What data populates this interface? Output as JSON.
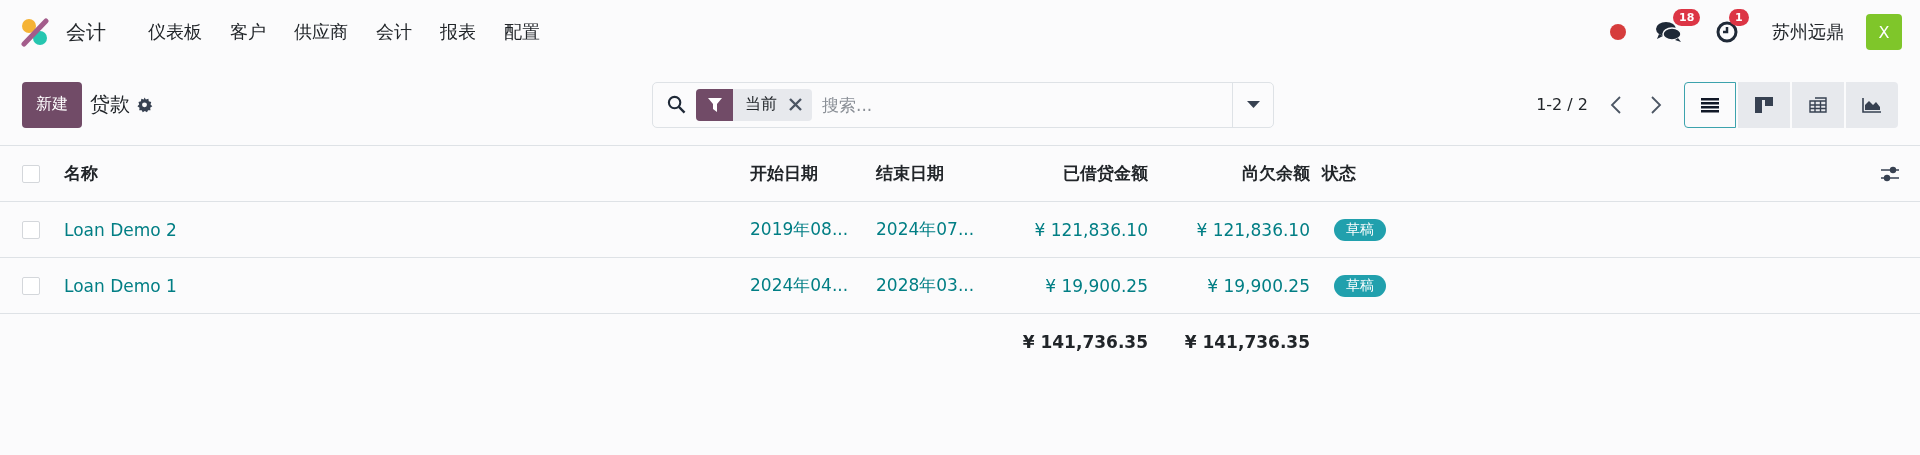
{
  "navbar": {
    "app_name": "会计",
    "menu": [
      "仪表板",
      "客户",
      "供应商",
      "会计",
      "报表",
      "配置"
    ],
    "messages_badge": "18",
    "activities_badge": "1",
    "company": "苏州远鼎",
    "avatar": "X"
  },
  "control_panel": {
    "new_button": "新建",
    "title": "贷款",
    "search": {
      "facet": "当前",
      "placeholder": "搜索..."
    },
    "pager": "1-2 / 2",
    "views": [
      {
        "kind": "list",
        "selected": true
      },
      {
        "kind": "kanban",
        "selected": false
      },
      {
        "kind": "pivot",
        "selected": false
      },
      {
        "kind": "graph",
        "selected": false
      }
    ]
  },
  "table": {
    "select_all_checked": false,
    "columns": [
      "名称",
      "开始日期",
      "结束日期",
      "已借贷金额",
      "尚欠余额",
      "状态"
    ],
    "rows": [
      {
        "name": "Loan Demo 2",
        "start": "2019年08...",
        "end": "2024年07...",
        "borrowed": "¥ 121,836.10",
        "outstanding": "¥ 121,836.10",
        "status": "草稿",
        "checked": false
      },
      {
        "name": "Loan Demo 1",
        "start": "2024年04...",
        "end": "2028年03...",
        "borrowed": "¥ 19,900.25",
        "outstanding": "¥ 19,900.25",
        "status": "草稿",
        "checked": false
      }
    ],
    "totals": {
      "borrowed": "¥ 141,736.35",
      "outstanding": "¥ 141,736.35"
    }
  }
}
